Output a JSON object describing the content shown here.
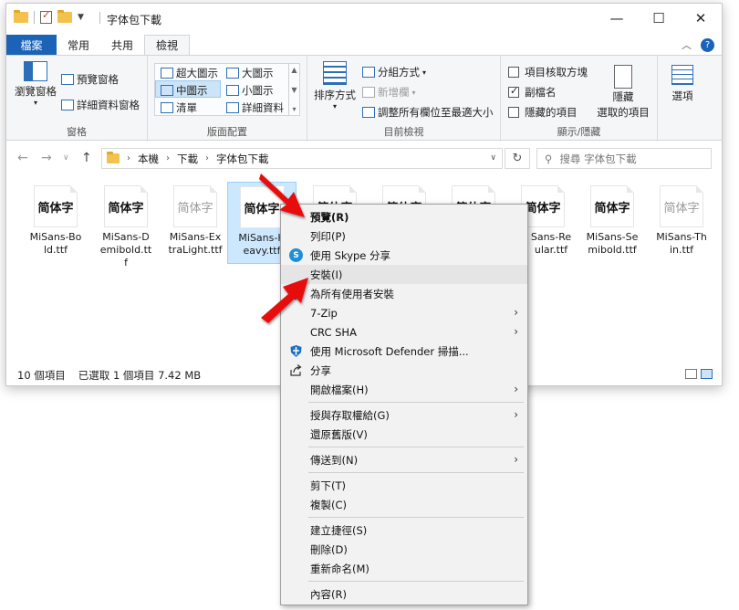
{
  "window": {
    "title": "字体包下載",
    "controls": {
      "minimize": "—",
      "maximize": "☐",
      "close": "✕"
    }
  },
  "ribbon": {
    "tabs": [
      "檔案",
      "常用",
      "共用",
      "檢視"
    ],
    "active_tab": "檢視",
    "help": "?",
    "groups": {
      "panes": {
        "label": "窗格",
        "nav_pane": "瀏覽窗格",
        "preview_pane": "預覽窗格",
        "details_pane": "詳細資料窗格"
      },
      "layout": {
        "label": "版面配置",
        "items": [
          "超大圖示",
          "大圖示",
          "中圖示",
          "小圖示",
          "清單",
          "詳細資料"
        ],
        "selected": "中圖示"
      },
      "current_view": {
        "label": "目前檢視",
        "sort_by": "排序方式",
        "group_by": "分組方式",
        "add_columns": "新增欄",
        "size_columns": "調整所有欄位至最適大小"
      },
      "show_hide": {
        "label": "顯示/隱藏",
        "item_checkboxes": "項目核取方塊",
        "file_extensions": "副檔名",
        "hidden_items": "隱藏的項目",
        "hide_selected_line1": "隱藏",
        "hide_selected_line2": "選取的項目",
        "options": "選項"
      }
    }
  },
  "address": {
    "breadcrumb": [
      "本機",
      "下載",
      "字体包下載"
    ],
    "search_placeholder": "搜尋 字体包下載"
  },
  "files": [
    {
      "name": "MiSans-Bold.ttf",
      "preview": "简体字",
      "weight": "bold"
    },
    {
      "name": "MiSans-Demibold.ttf",
      "preview": "简体字",
      "weight": "bold"
    },
    {
      "name": "MiSans-ExtraLight.ttf",
      "preview": "简体字",
      "weight": "light"
    },
    {
      "name": "MiSans-Heavy.ttf",
      "preview": "简体字",
      "weight": "bold",
      "selected": true
    },
    {
      "name": "",
      "preview": "简体字",
      "weight": "bold"
    },
    {
      "name": "",
      "preview": "简体字",
      "weight": "bold"
    },
    {
      "name": "",
      "preview": "简体字",
      "weight": "bold"
    },
    {
      "name": "MiSans-Regular.ttf",
      "preview": "简体字",
      "weight": "bold"
    },
    {
      "name": "MiSans-Semibold.ttf",
      "preview": "简体字",
      "weight": "bold"
    },
    {
      "name": "MiSans-Thin.ttf",
      "preview": "简体字",
      "weight": "light"
    }
  ],
  "file_labels": {
    "f0": "MiSans-Bo\nld.ttf",
    "f1": "MiSans-D\nemibold.tt\nf",
    "f2": "MiSans-Ex\ntraLight.ttf",
    "f3": "MiSans-H\neavy.ttf",
    "f7": "Sans-Re\nular.ttf",
    "f8": "MiSans-Se\nmibold.ttf",
    "f9": "MiSans-Th\nin.ttf"
  },
  "status": {
    "count": "10 個項目",
    "selection": "已選取 1 個項目  7.42 MB"
  },
  "context_menu": {
    "items": [
      {
        "label": "預覽(R)",
        "bold": true
      },
      {
        "label": "列印(P)"
      },
      {
        "label": "使用 Skype 分享",
        "icon": "skype-icon"
      },
      {
        "label": "安裝(I)",
        "hover": true
      },
      {
        "label": "為所有使用者安裝",
        "icon": "uac-shield-icon"
      },
      {
        "label": "7-Zip",
        "submenu": true
      },
      {
        "label": "CRC SHA",
        "submenu": true
      },
      {
        "label": "使用 Microsoft Defender 掃描...",
        "icon": "defender-icon"
      },
      {
        "label": "分享",
        "icon": "share-icon"
      },
      {
        "label": "開啟檔案(H)",
        "submenu": true
      },
      {
        "separator": true
      },
      {
        "label": "授與存取權給(G)",
        "submenu": true
      },
      {
        "label": "還原舊版(V)"
      },
      {
        "separator": true
      },
      {
        "label": "傳送到(N)",
        "submenu": true
      },
      {
        "separator": true
      },
      {
        "label": "剪下(T)"
      },
      {
        "label": "複製(C)"
      },
      {
        "separator": true
      },
      {
        "label": "建立捷徑(S)"
      },
      {
        "label": "刪除(D)"
      },
      {
        "label": "重新命名(M)"
      },
      {
        "separator": true
      },
      {
        "label": "內容(R)"
      }
    ]
  },
  "colors": {
    "accent": "#1a63b7",
    "selection": "#cce8ff",
    "arrow": "#e81010"
  }
}
